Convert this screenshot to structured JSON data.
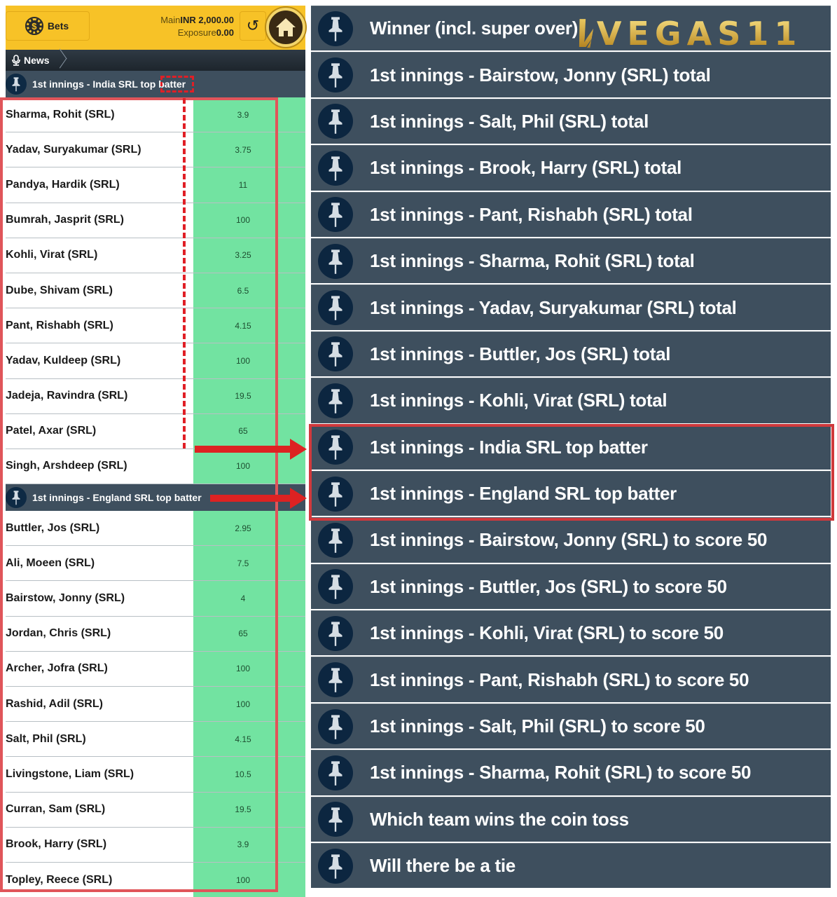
{
  "header": {
    "bets_label": "Bets",
    "main_label": "Main",
    "main_value": "INR 2,000.00",
    "exposure_label": "Exposure",
    "exposure_value": "0.00",
    "refresh_icon": "refresh-icon",
    "home_icon": "home-icon"
  },
  "newsbar": {
    "label": "News",
    "icon": "microphone-icon"
  },
  "left_markets": [
    {
      "title": "1st innings - India SRL top batter",
      "runners": [
        {
          "name": "Sharma, Rohit (SRL)",
          "odds": "3.9"
        },
        {
          "name": "Yadav, Suryakumar (SRL)",
          "odds": "3.75"
        },
        {
          "name": "Pandya, Hardik (SRL)",
          "odds": "11"
        },
        {
          "name": "Bumrah, Jasprit (SRL)",
          "odds": "100"
        },
        {
          "name": "Kohli, Virat (SRL)",
          "odds": "3.25"
        },
        {
          "name": "Dube, Shivam (SRL)",
          "odds": "6.5"
        },
        {
          "name": "Pant, Rishabh (SRL)",
          "odds": "4.15"
        },
        {
          "name": "Yadav, Kuldeep (SRL)",
          "odds": "100"
        },
        {
          "name": "Jadeja, Ravindra (SRL)",
          "odds": "19.5"
        },
        {
          "name": "Patel, Axar (SRL)",
          "odds": "65"
        },
        {
          "name": "Singh, Arshdeep (SRL)",
          "odds": "100"
        }
      ]
    },
    {
      "title": "1st innings - England SRL top batter",
      "runners": [
        {
          "name": "Buttler, Jos (SRL)",
          "odds": "2.95"
        },
        {
          "name": "Ali, Moeen (SRL)",
          "odds": "7.5"
        },
        {
          "name": "Bairstow, Jonny (SRL)",
          "odds": "4"
        },
        {
          "name": "Jordan, Chris (SRL)",
          "odds": "65"
        },
        {
          "name": "Archer, Jofra (SRL)",
          "odds": "100"
        },
        {
          "name": "Rashid, Adil (SRL)",
          "odds": "100"
        },
        {
          "name": "Salt, Phil (SRL)",
          "odds": "4.15"
        },
        {
          "name": "Livingstone, Liam (SRL)",
          "odds": "10.5"
        },
        {
          "name": "Curran, Sam (SRL)",
          "odds": "19.5"
        },
        {
          "name": "Brook, Harry (SRL)",
          "odds": "3.9"
        },
        {
          "name": "Topley, Reece (SRL)",
          "odds": "100"
        }
      ]
    }
  ],
  "brand": {
    "mark": "V/",
    "name": "VEGAS11"
  },
  "right_markets": [
    "Winner (incl. super over)",
    "1st innings - Bairstow, Jonny (SRL) total",
    "1st innings - Salt, Phil (SRL) total",
    "1st innings - Brook, Harry (SRL) total",
    "1st innings - Pant, Rishabh (SRL) total",
    "1st innings - Sharma, Rohit (SRL) total",
    "1st innings - Yadav, Suryakumar (SRL) total",
    "1st innings - Buttler, Jos (SRL) total",
    "1st innings - Kohli, Virat (SRL) total",
    "1st innings - India SRL top batter",
    "1st innings - England SRL top batter",
    "1st innings - Bairstow, Jonny (SRL) to score 50",
    "1st innings - Buttler, Jos (SRL) to score 50",
    "1st innings - Kohli, Virat (SRL) to score 50",
    "1st innings - Pant, Rishabh (SRL) to score 50",
    "1st innings - Salt, Phil (SRL) to score 50",
    "1st innings - Sharma, Rohit (SRL) to score 50",
    "Which team wins the coin toss",
    "Will there be a tie"
  ],
  "highlighted_right_markets": [
    9,
    10
  ],
  "colors": {
    "header_yellow": "#f7c227",
    "market_bar": "#3e4f5e",
    "odds_green": "#72e3a1",
    "annotation_red": "#dd2222"
  }
}
